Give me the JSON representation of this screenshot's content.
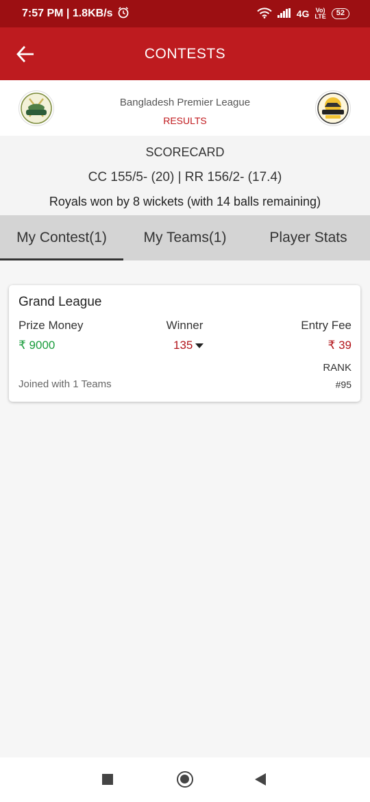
{
  "status_bar": {
    "time": "7:57 PM | 1.8KB/s",
    "network": "4G",
    "volte_top": "Vo)",
    "volte_bottom": "LTE",
    "battery": "52"
  },
  "app_bar": {
    "title": "CONTESTS",
    "back_icon": "arrow-left-icon"
  },
  "match": {
    "league": "Bangladesh Premier League",
    "status": "RESULTS"
  },
  "scorecard": {
    "title": "SCORECARD",
    "score": "CC 155/5- (20)  |  RR 156/2- (17.4)",
    "result": "Royals won by 8 wickets (with 14 balls remaining)"
  },
  "tabs": [
    {
      "label": "My Contest(1)",
      "active": true
    },
    {
      "label": "My Teams(1)",
      "active": false
    },
    {
      "label": "Player Stats",
      "active": false
    }
  ],
  "contest": {
    "name": "Grand League",
    "prize_label": "Prize Money",
    "prize_value": "₹ 9000",
    "winner_label": "Winner",
    "winner_value": "135",
    "fee_label": "Entry Fee",
    "fee_value": "₹ 39",
    "rank_label": "RANK",
    "rank_value": "#95",
    "joined": "Joined with 1 Teams"
  },
  "colors": {
    "status_bar": "#9c0f12",
    "app_bar": "#be1b1f",
    "prize_green": "#1a9c3c",
    "accent_red": "#b2141a"
  }
}
